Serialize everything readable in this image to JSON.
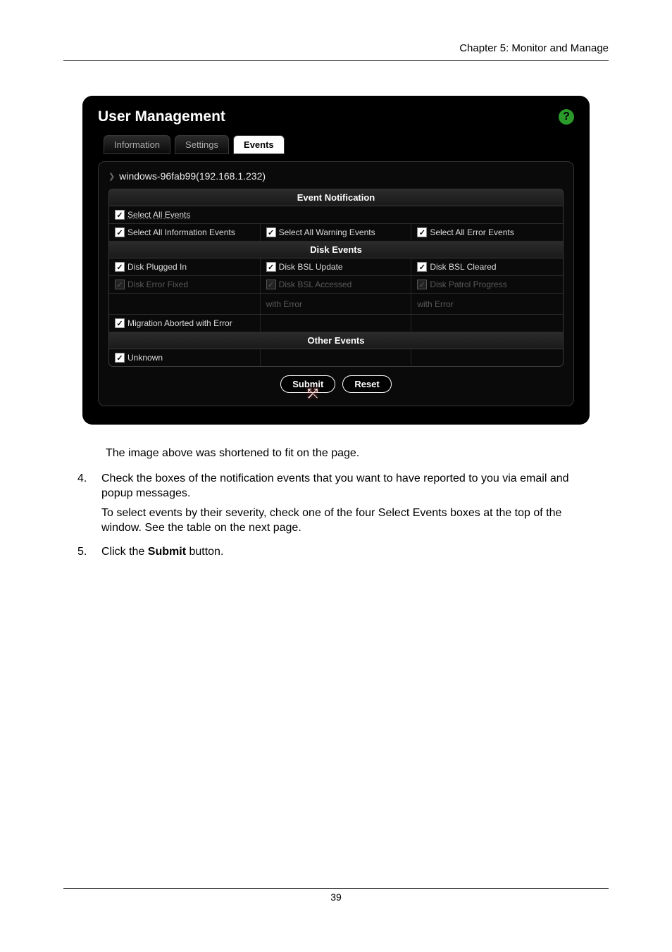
{
  "page": {
    "header": "Chapter 5: Monitor and Manage",
    "number": "39"
  },
  "screenshot": {
    "title": "User Management",
    "tabs": {
      "information": "Information",
      "settings": "Settings",
      "events": "Events"
    },
    "host": "windows-96fab99(192.168.1.232)",
    "section_event_notification": "Event Notification",
    "select_all_events": "Select All Events",
    "select_all_info": "Select All Information Events",
    "select_all_warn": "Select All Warning Events",
    "select_all_error": "Select All Error Events",
    "section_disk_events": "Disk Events",
    "disk_plugged_in": "Disk Plugged In",
    "disk_bsl_update": "Disk BSL Update",
    "disk_bsl_cleared": "Disk BSL Cleared",
    "disk_error_fixed": "Disk Error Fixed",
    "disk_bsl_accessed": "Disk BSL Accessed",
    "disk_patrol_progress": "Disk Patrol Progress",
    "with_error_a": "with Error",
    "with_error_b": "with Error",
    "migration_aborted": "Migration Aborted with Error",
    "section_other_events": "Other Events",
    "unknown": "Unknown",
    "submit": "Submit",
    "reset": "Reset"
  },
  "body": {
    "caption": "The image above was shortened to fit on the page.",
    "step4_num": "4.",
    "step4a": "Check the boxes of the notification events that you want to have reported to you via email and popup messages.",
    "step4b": "To select events by their severity, check one of the four Select Events boxes at the top of the window. See the table on the next page.",
    "step5_num": "5.",
    "step5_a": "Click the ",
    "step5_b": "Submit",
    "step5_c": " button."
  }
}
